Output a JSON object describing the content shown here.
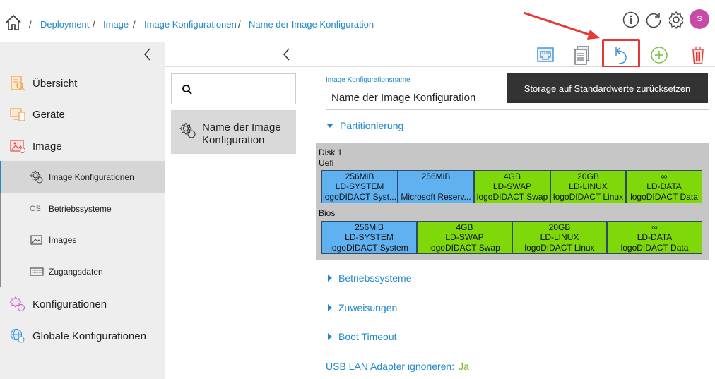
{
  "breadcrumb": [
    {
      "label": "Deployment"
    },
    {
      "label": "Image"
    },
    {
      "label": "Image Konfigurationen"
    },
    {
      "label": "Name der Image Konfiguration"
    }
  ],
  "user": {
    "initial": "S",
    "avatar_color": "#c94aa6"
  },
  "sidebar": {
    "items": [
      {
        "label": "Übersicht",
        "icon": "overview-icon"
      },
      {
        "label": "Geräte",
        "icon": "devices-icon"
      },
      {
        "label": "Image",
        "icon": "image-icon"
      },
      {
        "label": "Konfigurationen",
        "icon": "config-gear-icon"
      },
      {
        "label": "Globale Konfigurationen",
        "icon": "global-config-icon"
      }
    ],
    "subitems": [
      {
        "label": "Image Konfigurationen",
        "icon": "image-config-icon",
        "active": true
      },
      {
        "label": "Betriebssysteme",
        "icon_text": "OS"
      },
      {
        "label": "Images",
        "icon": "images-icon"
      },
      {
        "label": "Zugangsdaten",
        "icon": "credentials-icon"
      }
    ]
  },
  "list": {
    "entry_label": "Name der Image Konfiguration"
  },
  "form": {
    "name_label": "Image Konfigurationsname",
    "name_value": "Name der Image Konfiguration"
  },
  "tooltip": "Storage auf Standardwerte zurücksetzen",
  "sections": {
    "partitionierung": "Partitionierung",
    "betriebssysteme": "Betriebssysteme",
    "zuweisungen": "Zuweisungen",
    "boot_timeout": "Boot Timeout"
  },
  "disk": {
    "title": "Disk 1",
    "uefi_label": "Uefi",
    "bios_label": "Bios",
    "uefi": [
      {
        "size": "256MiB",
        "name": "LD-SYSTEM",
        "desc": "logoDIDACT Syst...",
        "color": "blue"
      },
      {
        "size": "256MiB",
        "name": "",
        "desc": "Microsoft Reserv...",
        "color": "blue"
      },
      {
        "size": "4GB",
        "name": "LD-SWAP",
        "desc": "logoDIDACT Swap",
        "color": "green"
      },
      {
        "size": "20GB",
        "name": "LD-LINUX",
        "desc": "logoDIDACT Linux",
        "color": "green"
      },
      {
        "size": "∞",
        "name": "LD-DATA",
        "desc": "logoDIDACT Data",
        "color": "green"
      }
    ],
    "bios": [
      {
        "size": "256MiB",
        "name": "LD-SYSTEM",
        "desc": "logoDIDACT System",
        "color": "blue"
      },
      {
        "size": "4GB",
        "name": "LD-SWAP",
        "desc": "logoDIDACT Swap",
        "color": "green"
      },
      {
        "size": "20GB",
        "name": "LD-LINUX",
        "desc": "logoDIDACT Linux",
        "color": "green"
      },
      {
        "size": "∞",
        "name": "LD-DATA",
        "desc": "logoDIDACT Data",
        "color": "green"
      }
    ]
  },
  "usb": {
    "label": "USB LAN Adapter ignorieren:",
    "value": "Ja"
  },
  "colors": {
    "accent": "#1e88c8",
    "partition_blue": "#5fb1f0",
    "partition_green": "#7fd80a",
    "delete_red": "#e53935",
    "add_green": "#7cc242"
  }
}
